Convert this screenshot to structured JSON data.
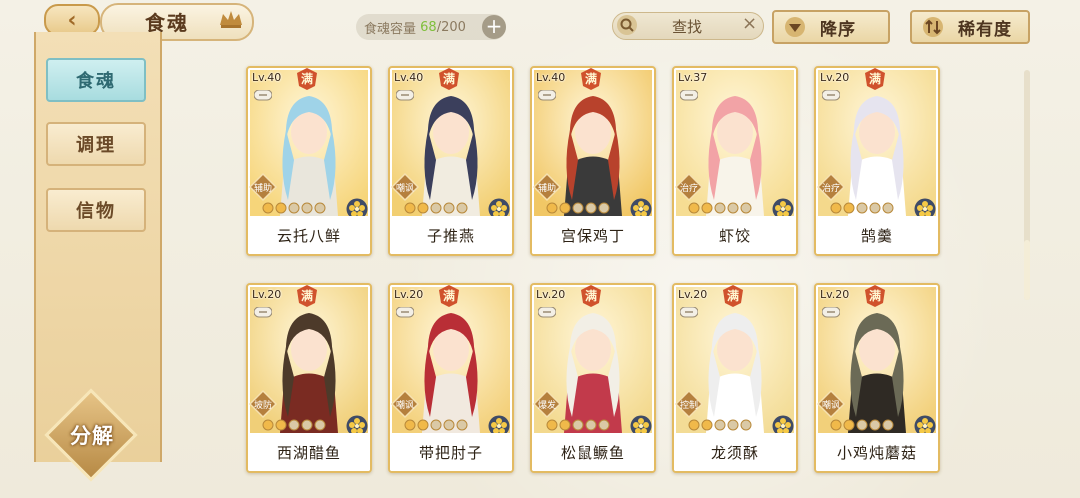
{
  "header": {
    "back_label": "‹",
    "title": "食魂",
    "capacity_label": "食魂容量",
    "capacity_current": "68",
    "capacity_max": "/200",
    "plus_label": "+",
    "search_label": "查找",
    "search_clear": "×",
    "sort_order": "降序",
    "sort_by": "稀有度"
  },
  "sidebar": {
    "items": [
      {
        "label": "食魂",
        "active": true
      },
      {
        "label": "调理",
        "active": false
      },
      {
        "label": "信物",
        "active": false
      }
    ],
    "decompose_label": "分解"
  },
  "colors": {
    "accent_gold": "#e3bb62",
    "active_tab": "#a8dcdf",
    "capacity_green": "#7fbf3c"
  },
  "cards": [
    {
      "level": "Lv.40",
      "max": "满",
      "role": "辅助",
      "name": "云托八鲜",
      "stars": 5
    },
    {
      "level": "Lv.40",
      "max": "满",
      "role": "嘲讽",
      "name": "子推燕",
      "stars": 5
    },
    {
      "level": "Lv.40",
      "max": "满",
      "role": "辅助",
      "name": "宫保鸡丁",
      "stars": 5
    },
    {
      "level": "Lv.37",
      "max": "",
      "role": "治疗",
      "name": "虾饺",
      "stars": 5
    },
    {
      "level": "Lv.20",
      "max": "满",
      "role": "治疗",
      "name": "鹄羹",
      "stars": 5
    },
    {
      "level": "Lv.20",
      "max": "满",
      "role": "坡防",
      "name": "西湖醋鱼",
      "stars": 5
    },
    {
      "level": "Lv.20",
      "max": "满",
      "role": "嘲讽",
      "name": "带把肘子",
      "stars": 5
    },
    {
      "level": "Lv.20",
      "max": "满",
      "role": "爆发",
      "name": "松鼠鳜鱼",
      "stars": 5
    },
    {
      "level": "Lv.20",
      "max": "满",
      "role": "控制",
      "name": "龙须酥",
      "stars": 5
    },
    {
      "level": "Lv.20",
      "max": "满",
      "role": "嘲讽",
      "name": "小鸡炖蘑菇",
      "stars": 5
    }
  ]
}
